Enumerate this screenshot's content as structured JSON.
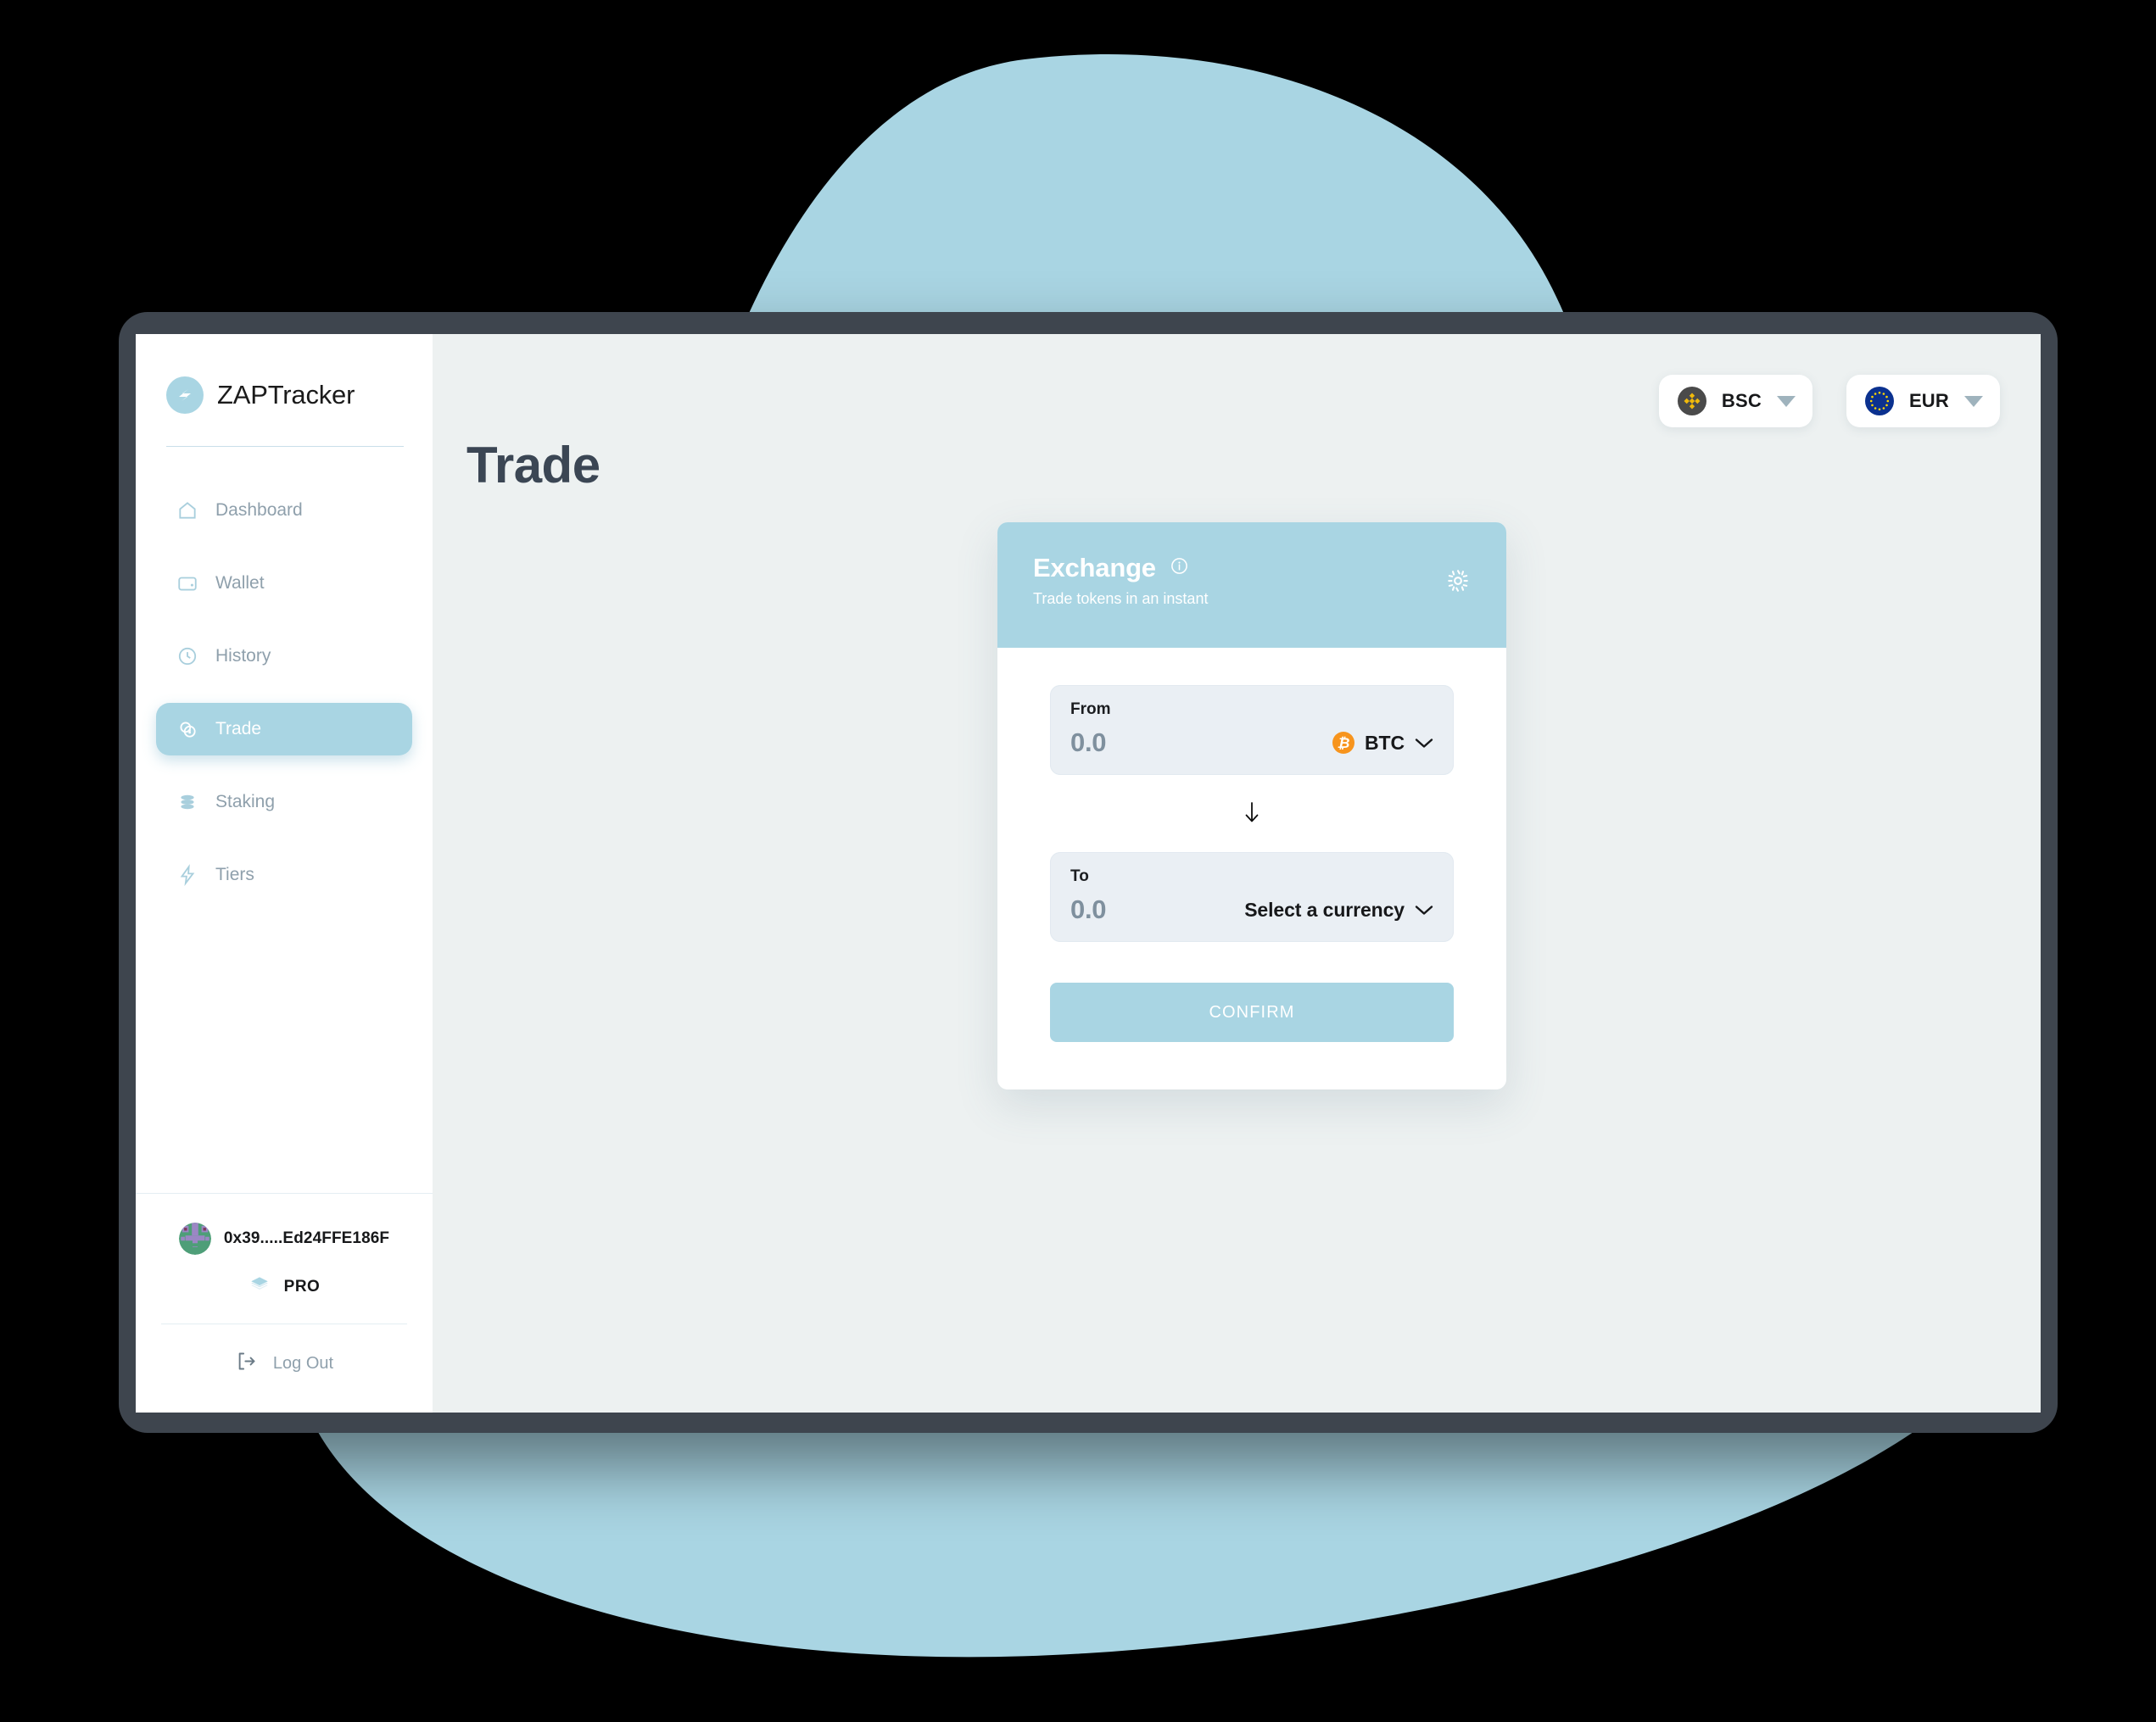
{
  "brand": {
    "name": "ZAPTracker",
    "logo_icon": "zap-logo-icon"
  },
  "sidebar": {
    "items": [
      {
        "label": "Dashboard",
        "icon": "home-icon",
        "active": false
      },
      {
        "label": "Wallet",
        "icon": "wallet-card-icon",
        "active": false
      },
      {
        "label": "History",
        "icon": "clock-icon",
        "active": false
      },
      {
        "label": "Trade",
        "icon": "coins-icon",
        "active": true
      },
      {
        "label": "Staking",
        "icon": "database-stack-icon",
        "active": false
      },
      {
        "label": "Tiers",
        "icon": "lightning-bolt-icon",
        "active": false
      }
    ],
    "user": {
      "address": "0x39.....Ed24FFE186F",
      "avatar_icon": "identicon-avatar",
      "tier_label": "PRO",
      "tier_icon": "layers-icon",
      "logout_label": "Log Out",
      "logout_icon": "logout-icon"
    }
  },
  "topbar": {
    "network": {
      "label": "BSC",
      "icon": "binance-smart-chain-icon",
      "caret_icon": "caret-down-icon"
    },
    "currency": {
      "label": "EUR",
      "icon": "euro-flag-icon",
      "caret_icon": "caret-down-icon"
    }
  },
  "main": {
    "page_title": "Trade"
  },
  "exchange": {
    "title": "Exchange",
    "subtitle": "Trade tokens in an instant",
    "info_icon": "info-circle-icon",
    "settings_icon": "gear-icon",
    "from": {
      "label": "From",
      "value": "0.0",
      "currency": "BTC",
      "currency_icon": "bitcoin-icon",
      "chevron_icon": "chevron-down-icon"
    },
    "swap_icon": "arrow-down-icon",
    "to": {
      "label": "To",
      "value": "0.0",
      "currency": "Select a currency",
      "chevron_icon": "chevron-down-icon"
    },
    "confirm_label": "CONFIRM"
  },
  "colors": {
    "accent": "#a9d5e3",
    "page_bg": "#edf1f1",
    "bezel": "#3e454e",
    "title": "#3b4654",
    "bitcoin_orange": "#f7941d",
    "blob": "#a9d5e3"
  }
}
